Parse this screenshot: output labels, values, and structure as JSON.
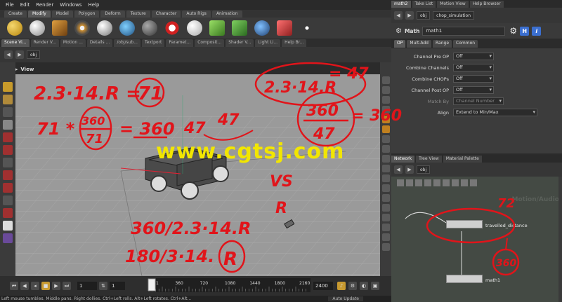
{
  "menu": [
    "File",
    "Edit",
    "Render",
    "Windows",
    "Help"
  ],
  "shelf_tabs": [
    {
      "label": "Create",
      "active": false
    },
    {
      "label": "Modify",
      "active": true
    },
    {
      "label": "Model",
      "active": false
    },
    {
      "label": "Polygon",
      "active": false
    },
    {
      "label": "Deform",
      "active": false
    },
    {
      "label": "Texture",
      "active": false
    },
    {
      "label": "Character",
      "active": false
    },
    {
      "label": "Auto Rigs",
      "active": false
    },
    {
      "label": "Animation",
      "active": false
    }
  ],
  "pane_tabs": [
    {
      "label": "Scene Vi...",
      "active": true
    },
    {
      "label": "Render V...",
      "active": false
    },
    {
      "label": "Motion ...",
      "active": false
    },
    {
      "label": "Details ...",
      "active": false
    },
    {
      "label": "/obj/sub...",
      "active": false
    },
    {
      "label": "Textport",
      "active": false
    },
    {
      "label": "Paramet...",
      "active": false
    },
    {
      "label": "Composit...",
      "active": false
    },
    {
      "label": "Shader V...",
      "active": false
    },
    {
      "label": "Light Li...",
      "active": false
    },
    {
      "label": "Help Br...",
      "active": false
    }
  ],
  "path": {
    "context": "obj"
  },
  "viewport": {
    "title": "View"
  },
  "timeline": {
    "start_field": "1",
    "current_field": "1",
    "ticks": [
      "1",
      "360",
      "720",
      "1080",
      "1440",
      "1800",
      "2160"
    ],
    "end_field": "2400",
    "auto_update": "Auto Update"
  },
  "status_text": "Left mouse tumbles. Middle pans. Right dollies. Ctrl+Left rolls. Alt+Left rotates. Ctrl+Alt...",
  "right_tabs": [
    {
      "label": "math2",
      "active": true
    },
    {
      "label": "Take List",
      "active": false
    },
    {
      "label": "Motion View",
      "active": false
    },
    {
      "label": "Help Browser",
      "active": false
    }
  ],
  "right_path": {
    "context": "obj",
    "node": "chop_simulation"
  },
  "param": {
    "type": "Math",
    "name": "math1",
    "tabs": [
      {
        "label": "OP",
        "active": true
      },
      {
        "label": "Mult-Add",
        "active": false
      },
      {
        "label": "Range",
        "active": false
      },
      {
        "label": "Common",
        "active": false
      }
    ],
    "rows": [
      {
        "label": "Channel Pre OP",
        "value": "Off"
      },
      {
        "label": "Combine Channels",
        "value": "Off"
      },
      {
        "label": "Combine CHOPs",
        "value": "Off"
      },
      {
        "label": "Channel Post OP",
        "value": "Off"
      },
      {
        "label": "Match By",
        "value": "Channel Number"
      },
      {
        "label": "Align",
        "value": "Extend to Min/Max"
      }
    ]
  },
  "net_tabs": [
    {
      "label": "Network",
      "active": true
    },
    {
      "label": "Tree View",
      "active": false
    },
    {
      "label": "Material Palette",
      "active": false
    }
  ],
  "net_path": {
    "context": "obj"
  },
  "network": {
    "watermark": "Motion/Audio",
    "nodes": [
      {
        "label": "travelled_distance"
      },
      {
        "label": "math1"
      }
    ]
  },
  "annotations": {
    "eq1_left": "2.3·14.R =",
    "eq1_right": "71",
    "eq2_lhs": "71 *",
    "eq2_num": "360",
    "eq2_den": "71",
    "eq2_rhs": "= 360",
    "top_right_lhs": "2.3·14.R",
    "top_right_rhs": "= 47",
    "mid_a": "47",
    "mid_b": "47",
    "frac_num": "360",
    "frac_den": "47",
    "frac_rhs": "= 360",
    "vs": "VS",
    "r": "R",
    "eq3": "360/2.3·14.R",
    "eq4_lhs": "180/3·14.",
    "eq4_r": "R",
    "net_note_a": "72",
    "net_note_b": "360",
    "watermark": "www.cgtsj.com"
  },
  "colors": {
    "ink": "#e1141a",
    "watermark": "#f2e600",
    "viewport": "#9a9a9a",
    "panel": "#3c3c3c",
    "menu_field": "#2b2b2b"
  }
}
